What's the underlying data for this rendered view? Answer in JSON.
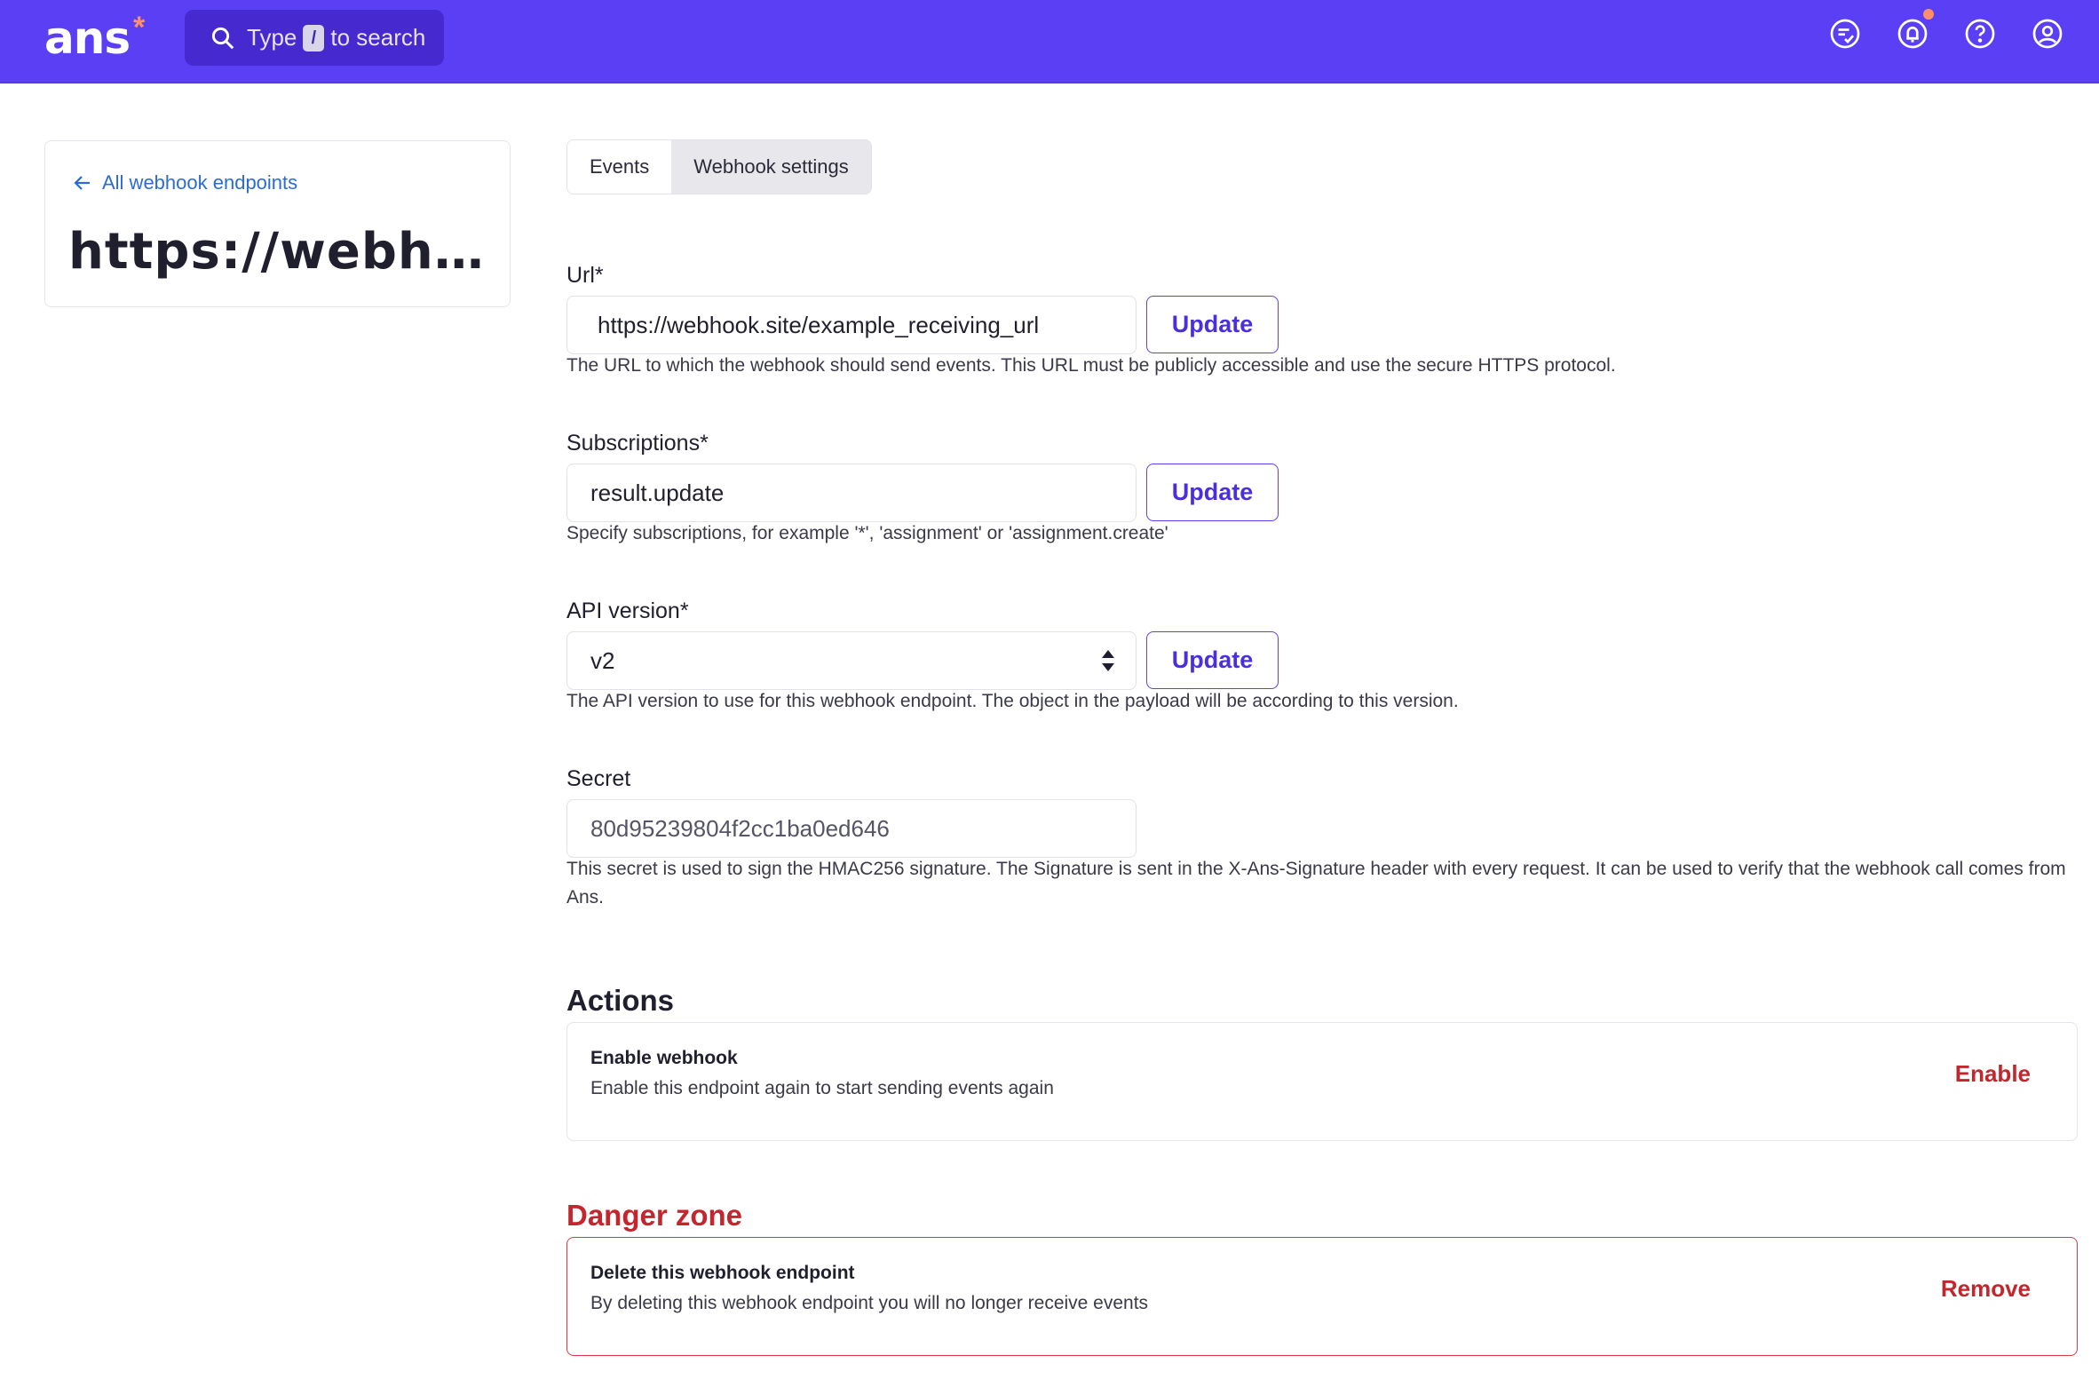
{
  "header": {
    "logo": "ans",
    "logo_mark": "*",
    "search": {
      "prefix": "Type",
      "key": "/",
      "suffix": "to search"
    },
    "icons": [
      "review-list-icon",
      "bell-icon",
      "help-icon",
      "account-icon"
    ]
  },
  "sidebar": {
    "back_link": "All webhook endpoints",
    "title": "https://webhook.site/example_receiving_url"
  },
  "tabs": [
    {
      "label": "Events",
      "active": false
    },
    {
      "label": "Webhook settings",
      "active": true
    }
  ],
  "form": {
    "url": {
      "label": "Url*",
      "value": "https://webhook.site/example_receiving_url",
      "button": "Update",
      "help": "The URL to which the webhook should send events. This URL must be publicly accessible and use the secure HTTPS protocol."
    },
    "subscriptions": {
      "label": "Subscriptions*",
      "value": "result.update",
      "button": "Update",
      "help": "Specify subscriptions, for example '*', 'assignment' or 'assignment.create'"
    },
    "api_version": {
      "label": "API version*",
      "value": "v2",
      "button": "Update",
      "help": "The API version to use for this webhook endpoint. The object in the payload will be according to this version."
    },
    "secret": {
      "label": "Secret",
      "value": "80d95239804f2cc1ba0ed646",
      "help": "This secret is used to sign the HMAC256 signature. The Signature is sent in the X-Ans-Signature header with every request. It can be used to verify that the webhook call comes from Ans."
    }
  },
  "actions": {
    "title": "Actions",
    "card": {
      "title": "Enable webhook",
      "description": "Enable this endpoint again to start sending events again",
      "button": "Enable"
    }
  },
  "danger": {
    "title": "Danger zone",
    "card": {
      "title": "Delete this webhook endpoint",
      "description": "By deleting this webhook endpoint you will no longer receive events",
      "button": "Remove"
    }
  },
  "colors": {
    "brand": "#5a3ff5",
    "danger": "#c4262e",
    "link": "#2b6bd6"
  }
}
